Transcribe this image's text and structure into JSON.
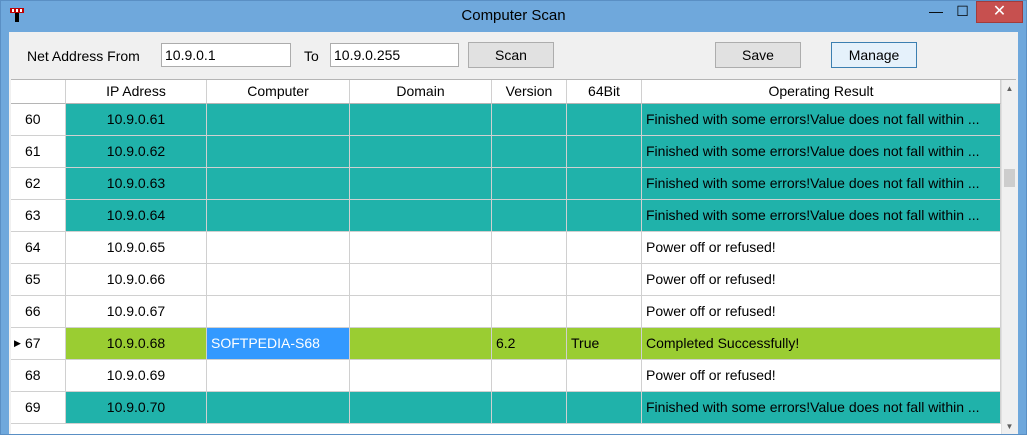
{
  "window": {
    "title": "Computer Scan",
    "minimize": "—",
    "maximize": "☐",
    "close": "✕"
  },
  "form": {
    "from_label": "Net Address From",
    "from_value": "10.9.0.1",
    "to_label": "To",
    "to_value": "10.9.0.255",
    "scan_label": "Scan",
    "save_label": "Save",
    "manage_label": "Manage"
  },
  "colors": {
    "error_row": "#20b2aa",
    "ok_row": "#9acd32",
    "selected_cell": "#3399ff"
  },
  "table": {
    "columns": [
      "",
      "IP Adress",
      "Computer",
      "Domain",
      "Version",
      "64Bit",
      "Operating Result"
    ],
    "rows": [
      {
        "num": "60",
        "ip": "10.9.0.61",
        "computer": "",
        "domain": "",
        "version": "",
        "bit64": "",
        "result": "Finished with some errors!Value does not fall within ...",
        "status": "error"
      },
      {
        "num": "61",
        "ip": "10.9.0.62",
        "computer": "",
        "domain": "",
        "version": "",
        "bit64": "",
        "result": "Finished with some errors!Value does not fall within ...",
        "status": "error"
      },
      {
        "num": "62",
        "ip": "10.9.0.63",
        "computer": "",
        "domain": "",
        "version": "",
        "bit64": "",
        "result": "Finished with some errors!Value does not fall within ...",
        "status": "error"
      },
      {
        "num": "63",
        "ip": "10.9.0.64",
        "computer": "",
        "domain": "",
        "version": "",
        "bit64": "",
        "result": "Finished with some errors!Value does not fall within ...",
        "status": "error"
      },
      {
        "num": "64",
        "ip": "10.9.0.65",
        "computer": "",
        "domain": "",
        "version": "",
        "bit64": "",
        "result": "Power off or refused!",
        "status": "off"
      },
      {
        "num": "65",
        "ip": "10.9.0.66",
        "computer": "",
        "domain": "",
        "version": "",
        "bit64": "",
        "result": "Power off or refused!",
        "status": "off"
      },
      {
        "num": "66",
        "ip": "10.9.0.67",
        "computer": "",
        "domain": "",
        "version": "",
        "bit64": "",
        "result": "Power off or refused!",
        "status": "off"
      },
      {
        "num": "67",
        "ip": "10.9.0.68",
        "computer": "SOFTPEDIA-S68",
        "domain": "",
        "version": "6.2",
        "bit64": "True",
        "result": "Completed Successfully!",
        "status": "ok",
        "current": true
      },
      {
        "num": "68",
        "ip": "10.9.0.69",
        "computer": "",
        "domain": "",
        "version": "",
        "bit64": "",
        "result": "Power off or refused!",
        "status": "off"
      },
      {
        "num": "69",
        "ip": "10.9.0.70",
        "computer": "",
        "domain": "",
        "version": "",
        "bit64": "",
        "result": "Finished with some errors!Value does not fall within ...",
        "status": "error"
      }
    ]
  }
}
